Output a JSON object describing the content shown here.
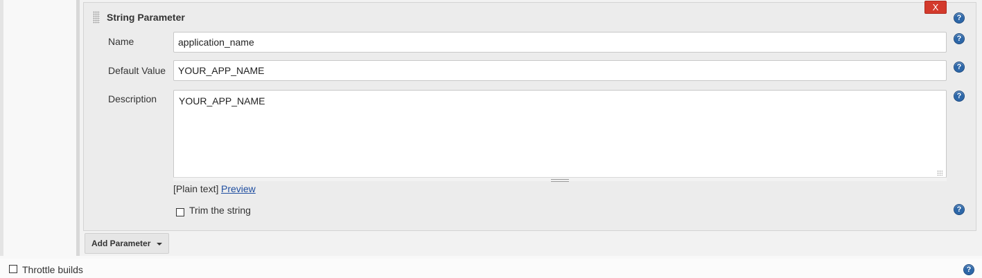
{
  "parameter_block": {
    "title": "String Parameter",
    "delete_label": "X",
    "help_glyph": "?",
    "fields": {
      "name": {
        "label": "Name",
        "value": "application_name"
      },
      "default_value": {
        "label": "Default Value",
        "value": "YOUR_APP_NAME"
      },
      "description": {
        "label": "Description",
        "value": "YOUR_APP_NAME"
      }
    },
    "markup": {
      "format_label": "[Plain text]",
      "preview_label": "Preview"
    },
    "trim": {
      "label": "Trim the string",
      "checked": false
    }
  },
  "add_parameter": {
    "label": "Add Parameter"
  },
  "throttle": {
    "label": "Throttle builds",
    "checked": false
  },
  "colors": {
    "delete_button": "#d33a2c",
    "help_icon": "#2d67a8",
    "link": "#1f4ea0"
  }
}
